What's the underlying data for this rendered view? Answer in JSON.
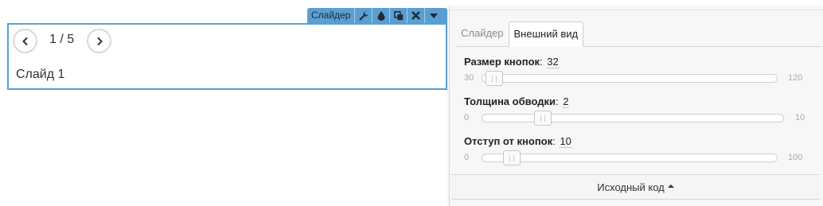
{
  "toolbar": {
    "label": "Слайдер",
    "icons": [
      "wrench-icon",
      "drop-icon",
      "copy-icon",
      "close-icon",
      "caret-down-icon"
    ],
    "color": "#5b9fd1"
  },
  "slider": {
    "counter": "1 / 5",
    "slide_text": "Слайд 1",
    "prev_icon": "chevron-left-icon",
    "next_icon": "chevron-right-icon"
  },
  "panel": {
    "tabs": [
      {
        "label": "Слайдер",
        "active": false
      },
      {
        "label": "Внешний вид",
        "active": true
      }
    ],
    "properties": [
      {
        "label": "Размер кнопок",
        "value": "32",
        "min": "30",
        "max": "120"
      },
      {
        "label": "Толщина обводки",
        "value": "2",
        "min": "0",
        "max": "10"
      },
      {
        "label": "Отступ от кнопок",
        "value": "10",
        "min": "0",
        "max": "100"
      }
    ],
    "source_label": "Исходный код"
  }
}
